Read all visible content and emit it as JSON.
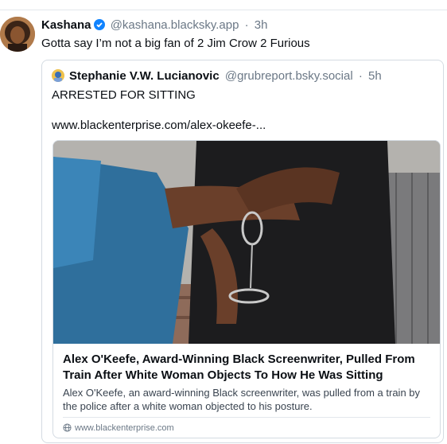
{
  "post": {
    "author_name": "Kashana",
    "author_handle": "@kashana.blacksky.app",
    "separator": "·",
    "time": "3h",
    "text": "Gotta say I’m not a big fan of 2 Jim Crow 2 Furious",
    "verified_icon": "verified-badge-icon"
  },
  "quote": {
    "author_name": "Stephanie V.W. Lucianovic",
    "author_handle": "@grubreport.bsky.social",
    "separator": "·",
    "time": "5h",
    "text": "ARRESTED FOR SITTING",
    "link_text": "www.blackenterprise.com/alex-okeefe-..."
  },
  "link_card": {
    "title": "Alex O'Keefe, Award-Winning Black Screenwriter, Pulled From Train After White Woman Objects To How He Was Sitting",
    "description": "Alex O'Keefe, an award-winning Black screenwriter, was pulled from a train by the police after a white woman objected to his posture.",
    "domain": "www.blackenterprise.com",
    "domain_icon": "globe-icon"
  },
  "colors": {
    "verified": "#1083fe",
    "muted_text": "#6b7886",
    "border": "#d4dbe2"
  }
}
